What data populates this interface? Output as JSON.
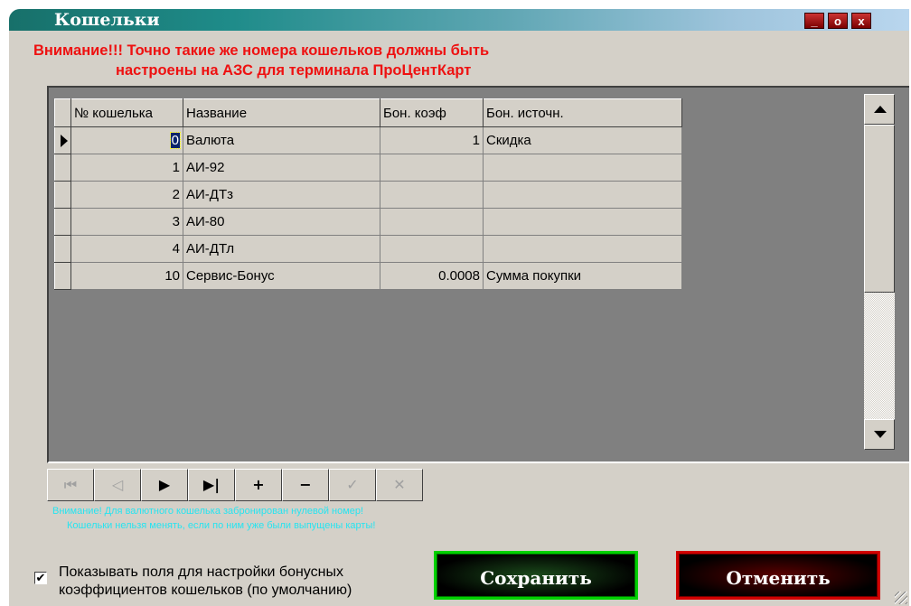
{
  "window": {
    "title": "Кошельки",
    "btn_min": "_",
    "btn_max": "o",
    "btn_close": "x"
  },
  "warning": {
    "line1": "Внимание!!! Точно такие же номера кошельков должны быть",
    "line2": "настроены на АЗС для терминала ПроЦентКарт"
  },
  "grid": {
    "columns": [
      "№ кошелька",
      "Название",
      "Бон. коэф",
      "Бон. источн."
    ],
    "rows": [
      {
        "num": "0",
        "name": "Валюта",
        "coef": "1",
        "source": "Скидка",
        "selected": true
      },
      {
        "num": "1",
        "name": "АИ-92",
        "coef": "",
        "source": ""
      },
      {
        "num": "2",
        "name": "АИ-ДТз",
        "coef": "",
        "source": ""
      },
      {
        "num": "3",
        "name": "АИ-80",
        "coef": "",
        "source": ""
      },
      {
        "num": "4",
        "name": "АИ-ДТл",
        "coef": "",
        "source": ""
      },
      {
        "num": "10",
        "name": "Сервис-Бонус",
        "coef": "0.0008",
        "source": "Сумма покупки"
      }
    ]
  },
  "navigator": {
    "first": "⏮",
    "prior": "◁",
    "next": "▶",
    "last": "▶|",
    "insert": "+",
    "delete": "−",
    "post": "✓",
    "cancel": "✕"
  },
  "notes": {
    "line1": "Внимание! Для валютного кошелька забронирован нулевой номер!",
    "line2": "Кошельки нельзя менять, если по ним уже были выпущены карты!"
  },
  "checkbox": {
    "checked_mark": "✔",
    "label_line1": "Показывать поля для настройки бонусных",
    "label_line2": "коэффициентов кошельков (по умолчанию)"
  },
  "buttons": {
    "save": "Сохранить",
    "cancel": "Отменить"
  },
  "colors": {
    "warning_red": "#ee1111",
    "note_cyan": "#26e4f0",
    "save_border": "#00d000",
    "cancel_border": "#d00000"
  }
}
